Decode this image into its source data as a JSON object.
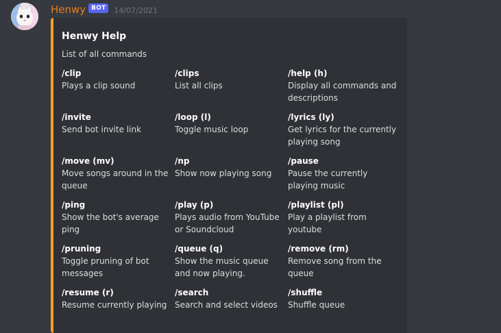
{
  "message": {
    "username": "Henwy",
    "bot_tag": "BOT",
    "timestamp": "14/07/2021",
    "avatar_icon": "cat-avatar-icon"
  },
  "embed": {
    "accent_color": "#f1a22b",
    "title": "Henwy Help",
    "description": "List of all commands",
    "fields": [
      {
        "name": "/clip",
        "value": "Plays a clip sound"
      },
      {
        "name": "/clips",
        "value": "List all clips"
      },
      {
        "name": "/help (h)",
        "value": "Display all commands and descriptions"
      },
      {
        "name": "/invite",
        "value": "Send bot invite link"
      },
      {
        "name": "/loop (l)",
        "value": "Toggle music loop"
      },
      {
        "name": "/lyrics (ly)",
        "value": "Get lyrics for the currently playing song"
      },
      {
        "name": "/move (mv)",
        "value": "Move songs around in the queue"
      },
      {
        "name": "/np",
        "value": "Show now playing song"
      },
      {
        "name": "/pause",
        "value": "Pause the currently playing music"
      },
      {
        "name": "/ping",
        "value": "Show the bot's average ping"
      },
      {
        "name": "/play (p)",
        "value": "Plays audio from YouTube or Soundcloud"
      },
      {
        "name": "/playlist (pl)",
        "value": "Play a playlist from youtube"
      },
      {
        "name": "/pruning",
        "value": "Toggle pruning of bot messages"
      },
      {
        "name": "/queue (q)",
        "value": "Show the music queue and now playing."
      },
      {
        "name": "/remove (rm)",
        "value": "Remove song from the queue"
      },
      {
        "name": "/resume (r)",
        "value": "Resume currently playing"
      },
      {
        "name": "/search",
        "value": "Search and select videos"
      },
      {
        "name": "/shuffle",
        "value": "Shuffle queue"
      }
    ]
  }
}
